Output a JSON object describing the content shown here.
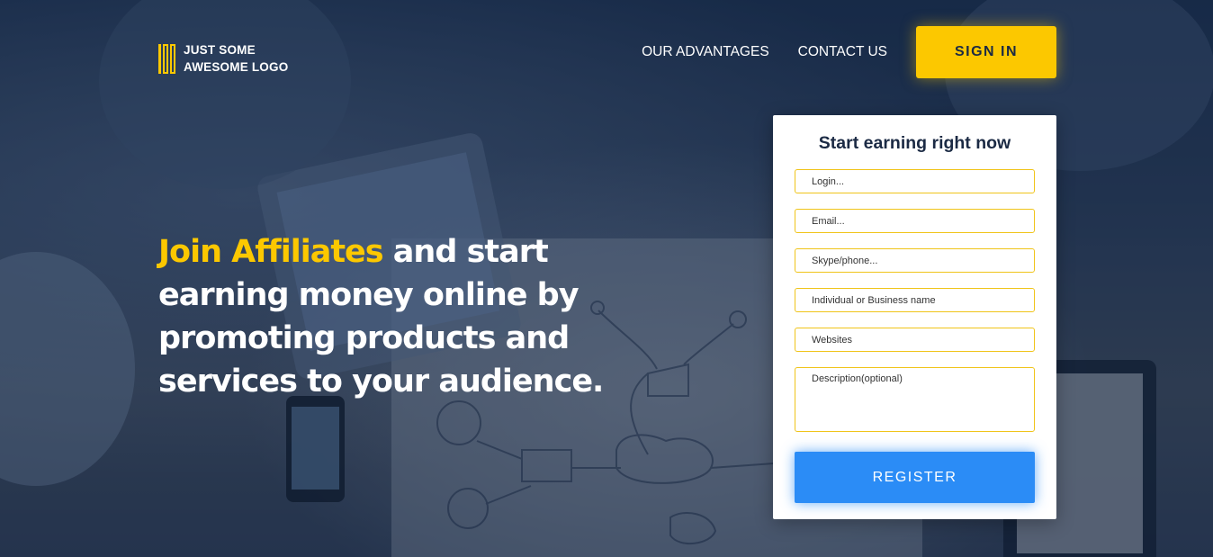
{
  "header": {
    "logo_text": "JUST SOME\nAWESOME LOGO",
    "nav": [
      "OUR ADVANTAGES",
      "CONTACT US"
    ],
    "signin_label": "SIGN IN"
  },
  "hero": {
    "headline_accent": "Join Affiliates",
    "headline_rest": " and start earning money online by promoting products and services to your audience."
  },
  "form": {
    "title": "Start earning right now",
    "fields": {
      "login": "Login...",
      "email": "Email...",
      "skype": "Skype/phone...",
      "name": "Individual or Business name",
      "websites": "Websites",
      "description": "Description(optional)"
    },
    "register_label": "REGISTER"
  },
  "colors": {
    "accent": "#fcc800",
    "primary": "#2b8cf6",
    "background": "#1c2f4d"
  }
}
